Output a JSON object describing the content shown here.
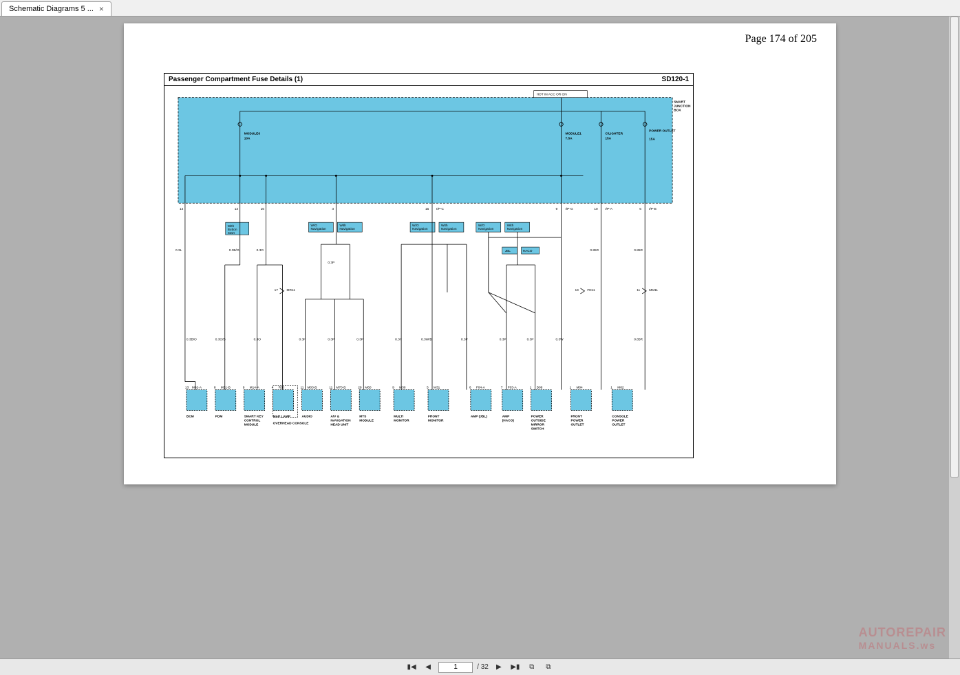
{
  "tab": {
    "title": "Schematic Diagrams 5 ..."
  },
  "page_label": "Page 174 of 205",
  "diagram": {
    "title": "Passenger Compartment Fuse Details (1)",
    "code": "SD120-1",
    "top_state": "HOT IN ACC OR ON",
    "junction_label": "SMART JUNCTION BOX",
    "fuses": [
      {
        "name": "MODULE6",
        "amp": "10A"
      },
      {
        "name": "MODULE1",
        "amp": "7.5A"
      },
      {
        "name": "C/LIGHTER",
        "amp": "15A"
      },
      {
        "name": "POWER OUTLET",
        "amp": "15A"
      }
    ],
    "conn_row": [
      {
        "pin": "14",
        "conn": ""
      },
      {
        "pin": "13",
        "conn": ""
      },
      {
        "pin": "16",
        "conn": ""
      },
      {
        "pin": "3",
        "conn": ""
      },
      {
        "pin": "15",
        "conn": "I/P-C"
      },
      {
        "pin": "9",
        "conn": "I/P-G"
      },
      {
        "pin": "10",
        "conn": "I/P-A"
      },
      {
        "pin": "6",
        "conn": "I/P-B"
      }
    ],
    "option_tags": [
      "With Button Start",
      "W/O Navigation",
      "With Navigation",
      "W/O Navigation",
      "With Navigation",
      "W/O Navigation",
      "With Navigation",
      "JBL",
      "HACO"
    ],
    "mid_conns": [
      {
        "pin": "17",
        "name": "MR11"
      },
      {
        "pin": "19",
        "name": "FD11"
      },
      {
        "pin": "11",
        "name": "MM11"
      }
    ],
    "wire_labels": [
      "0.3L",
      "0.3B/O",
      "0.3O",
      "0.3P",
      "0.3B/O",
      "0.3O/B",
      "0.3O",
      "0.3P",
      "0.3P",
      "0.3P",
      "0.3Y",
      "0.3W/B",
      "0.3P",
      "0.3P",
      "0.3P",
      "0.3W",
      "0.85R",
      "0.85R",
      "0.85R"
    ],
    "components": [
      {
        "pin": "13",
        "conn": "M02-A",
        "name": "BCM"
      },
      {
        "pin": "8",
        "conn": "M51-B",
        "name": "PDM"
      },
      {
        "pin": "9",
        "conn": "M14-A",
        "name": "SMART KEY CONTROL MODULE"
      },
      {
        "pin": "4",
        "conn": "R03",
        "name": "MAP LAMP",
        "sub": "OVERHEAD CONSOLE"
      },
      {
        "pin": "11",
        "conn": "M03-B",
        "name": "AUDIO"
      },
      {
        "pin": "11",
        "conn": "M70-B",
        "name": "A/V & NAVIGATION HEAD UNIT"
      },
      {
        "pin": "29",
        "conn": "M60",
        "name": "MTS MODULE"
      },
      {
        "pin": "9",
        "conn": "M30",
        "name": "MULTI MONITOR"
      },
      {
        "pin": "5",
        "conn": "M31",
        "name": "FRONT MONITOR"
      },
      {
        "pin": "6",
        "conn": "F04-A",
        "name": "AMP (JBL)"
      },
      {
        "pin": "7",
        "conn": "F03-A",
        "name": "AMP (HACO)"
      },
      {
        "pin": "1",
        "conn": "D09",
        "name": "POWER OUTSIDE MIRROR SWITCH"
      },
      {
        "pin": "1",
        "conn": "M04",
        "name": "FRONT POWER OUTLET"
      },
      {
        "pin": "1",
        "conn": "M82",
        "name": "CONSOLE POWER OUTLET"
      }
    ]
  },
  "nav": {
    "current": "1",
    "total": "32"
  },
  "watermark": {
    "line1": "AUTOREPAIR",
    "line2": "MANUALS.ws"
  }
}
